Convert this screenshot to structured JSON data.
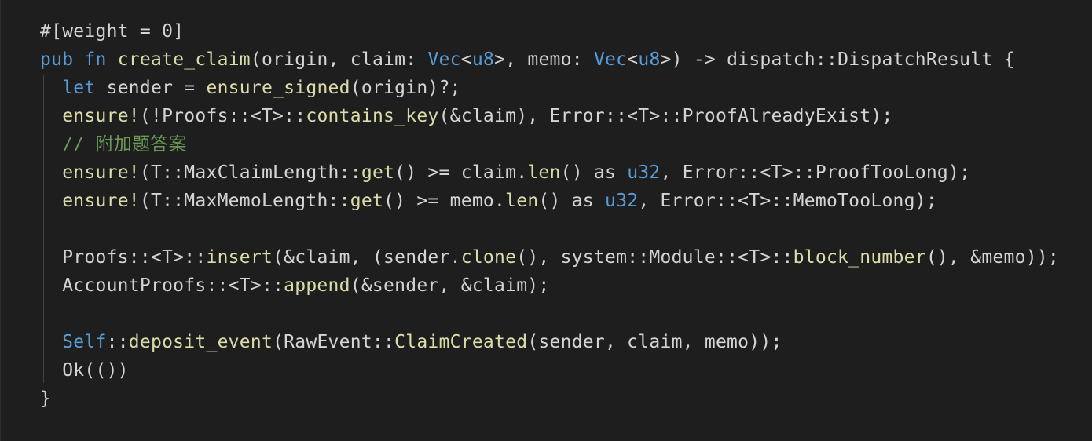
{
  "editor": {
    "language": "rust",
    "theme": "dark",
    "colors": {
      "background": "#1e1e1e",
      "default": "#d4d4d4",
      "keyword": "#569cd6",
      "function": "#dcdcaa",
      "type": "#4ec9b0",
      "comment": "#6a9955"
    },
    "lines": [
      [
        {
          "t": "#[weight = 0]",
          "c": "tx"
        }
      ],
      [
        {
          "t": "pub",
          "c": "kw"
        },
        {
          "t": " ",
          "c": "tx"
        },
        {
          "t": "fn",
          "c": "kw"
        },
        {
          "t": " ",
          "c": "tx"
        },
        {
          "t": "create_claim",
          "c": "fn"
        },
        {
          "t": "(origin, claim: ",
          "c": "tx"
        },
        {
          "t": "Vec",
          "c": "kw"
        },
        {
          "t": "<",
          "c": "tx"
        },
        {
          "t": "u8",
          "c": "kw"
        },
        {
          "t": ">, memo: ",
          "c": "tx"
        },
        {
          "t": "Vec",
          "c": "kw"
        },
        {
          "t": "<",
          "c": "tx"
        },
        {
          "t": "u8",
          "c": "kw"
        },
        {
          "t": ">) -> dispatch::DispatchResult {",
          "c": "tx"
        }
      ],
      [
        {
          "t": "  ",
          "c": "tx"
        },
        {
          "t": "let",
          "c": "kw"
        },
        {
          "t": " sender = ",
          "c": "tx"
        },
        {
          "t": "ensure_signed",
          "c": "fn"
        },
        {
          "t": "(origin)?;",
          "c": "tx"
        }
      ],
      [
        {
          "t": "  ",
          "c": "tx"
        },
        {
          "t": "ensure!",
          "c": "fn"
        },
        {
          "t": "(!Proofs::<T>::",
          "c": "tx"
        },
        {
          "t": "contains_key",
          "c": "fn"
        },
        {
          "t": "(&claim), Error::<T>::ProofAlreadyExist);",
          "c": "tx"
        }
      ],
      [
        {
          "t": "  ",
          "c": "tx"
        },
        {
          "t": "// 附加题答案",
          "c": "cm"
        }
      ],
      [
        {
          "t": "  ",
          "c": "tx"
        },
        {
          "t": "ensure!",
          "c": "fn"
        },
        {
          "t": "(T::MaxClaimLength::",
          "c": "tx"
        },
        {
          "t": "get",
          "c": "fn"
        },
        {
          "t": "() >= claim.",
          "c": "tx"
        },
        {
          "t": "len",
          "c": "fn"
        },
        {
          "t": "() as ",
          "c": "tx"
        },
        {
          "t": "u32",
          "c": "kw"
        },
        {
          "t": ", Error::<T>::ProofTooLong);",
          "c": "tx"
        }
      ],
      [
        {
          "t": "  ",
          "c": "tx"
        },
        {
          "t": "ensure!",
          "c": "fn"
        },
        {
          "t": "(T::MaxMemoLength::",
          "c": "tx"
        },
        {
          "t": "get",
          "c": "fn"
        },
        {
          "t": "() >= memo.",
          "c": "tx"
        },
        {
          "t": "len",
          "c": "fn"
        },
        {
          "t": "() as ",
          "c": "tx"
        },
        {
          "t": "u32",
          "c": "kw"
        },
        {
          "t": ", Error::<T>::MemoTooLong);",
          "c": "tx"
        }
      ],
      [],
      [
        {
          "t": "  Proofs::<T>::",
          "c": "tx"
        },
        {
          "t": "insert",
          "c": "fn"
        },
        {
          "t": "(&claim, (sender.",
          "c": "tx"
        },
        {
          "t": "clone",
          "c": "fn"
        },
        {
          "t": "(), system::Module::<T>::",
          "c": "tx"
        },
        {
          "t": "block_number",
          "c": "fn"
        },
        {
          "t": "(), &memo));",
          "c": "tx"
        }
      ],
      [
        {
          "t": "  AccountProofs::<T>::",
          "c": "tx"
        },
        {
          "t": "append",
          "c": "fn"
        },
        {
          "t": "(&sender, &claim);",
          "c": "tx"
        }
      ],
      [],
      [
        {
          "t": "  ",
          "c": "tx"
        },
        {
          "t": "Self",
          "c": "kw"
        },
        {
          "t": "::",
          "c": "tx"
        },
        {
          "t": "deposit_event",
          "c": "fn"
        },
        {
          "t": "(RawEvent::",
          "c": "tx"
        },
        {
          "t": "ClaimCreated",
          "c": "fn"
        },
        {
          "t": "(sender, claim, memo));",
          "c": "tx"
        }
      ],
      [
        {
          "t": "  Ok(())",
          "c": "tx"
        }
      ],
      [
        {
          "t": "}",
          "c": "tx"
        }
      ]
    ]
  }
}
